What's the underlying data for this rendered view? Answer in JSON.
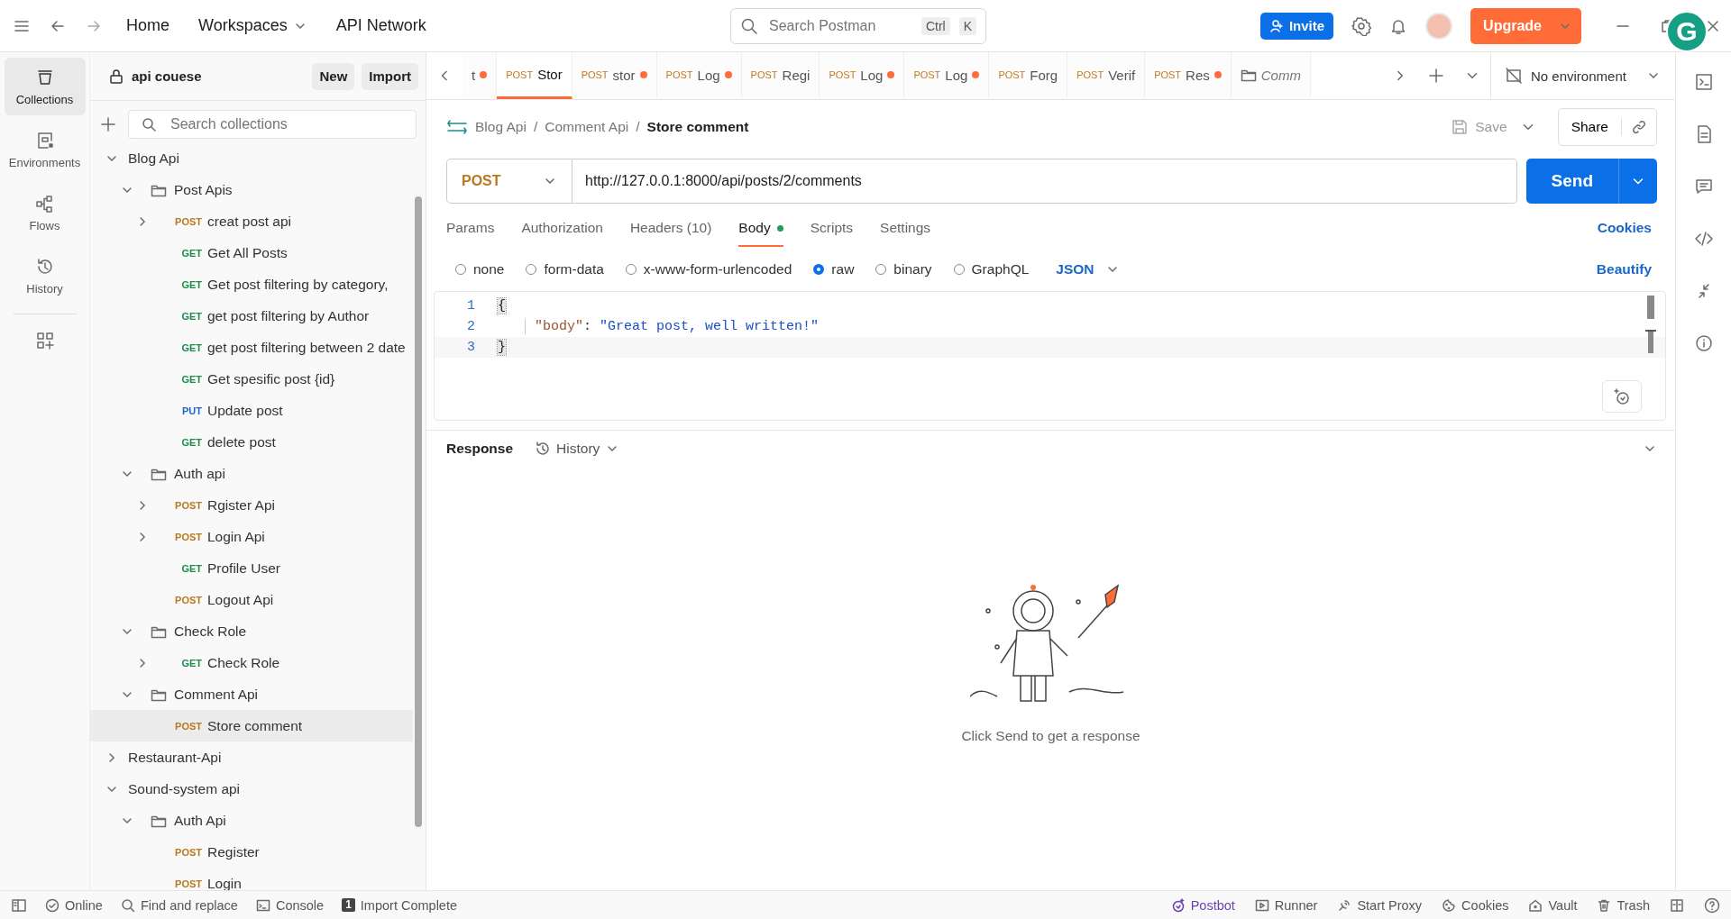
{
  "topbar": {
    "nav": [
      {
        "label": "Home",
        "dropdown": false
      },
      {
        "label": "Workspaces",
        "dropdown": true
      },
      {
        "label": "API Network",
        "dropdown": false
      }
    ],
    "search": {
      "placeholder": "Search Postman",
      "shortcut": [
        "Ctrl",
        "K"
      ]
    },
    "invite": "Invite",
    "upgrade": "Upgrade",
    "grammarly": "G"
  },
  "rail": [
    {
      "label": "Collections",
      "selected": true
    },
    {
      "label": "Environments",
      "selected": false
    },
    {
      "label": "Flows",
      "selected": false
    },
    {
      "label": "History",
      "selected": false
    }
  ],
  "sidebar": {
    "workspace": "api couese",
    "buttons": [
      "New",
      "Import"
    ],
    "search": {
      "placeholder": "Search collections"
    },
    "tree": [
      {
        "kind": "collection",
        "label": "Blog Api",
        "expanded": true,
        "selected": false,
        "children": [
          {
            "kind": "folder",
            "label": "Post Apis",
            "expanded": true,
            "selected": false,
            "children": [
              {
                "kind": "request",
                "method": "POST",
                "color": "#b7791f",
                "label": "creat post api",
                "expanded": false,
                "selected": false
              },
              {
                "kind": "request",
                "method": "GET",
                "color": "#1f8a4c",
                "label": "Get All Posts",
                "selected": false
              },
              {
                "kind": "request",
                "method": "GET",
                "color": "#1f8a4c",
                "label": "Get post filtering by category,",
                "selected": false
              },
              {
                "kind": "request",
                "method": "GET",
                "color": "#1f8a4c",
                "label": "get post filtering by Author",
                "selected": false
              },
              {
                "kind": "request",
                "method": "GET",
                "color": "#1f8a4c",
                "label": "get post filtering between 2 date",
                "selected": false
              },
              {
                "kind": "request",
                "method": "GET",
                "color": "#1f8a4c",
                "label": "Get spesific post {id}",
                "selected": false
              },
              {
                "kind": "request",
                "method": "PUT",
                "color": "#1b66c9",
                "label": "Update post",
                "selected": false
              },
              {
                "kind": "request",
                "method": "GET",
                "color": "#1f8a4c",
                "label": "delete post",
                "selected": false
              }
            ]
          },
          {
            "kind": "folder",
            "label": "Auth api",
            "expanded": true,
            "selected": false,
            "children": [
              {
                "kind": "request",
                "method": "POST",
                "color": "#b7791f",
                "label": "Rgister Api",
                "expanded": false,
                "selected": false
              },
              {
                "kind": "request",
                "method": "POST",
                "color": "#b7791f",
                "label": "Login Api",
                "expanded": false,
                "selected": false
              },
              {
                "kind": "request",
                "method": "GET",
                "color": "#1f8a4c",
                "label": "Profile User",
                "selected": false
              },
              {
                "kind": "request",
                "method": "POST",
                "color": "#b7791f",
                "label": "Logout Api",
                "selected": false
              }
            ]
          },
          {
            "kind": "folder",
            "label": "Check Role",
            "expanded": true,
            "selected": false,
            "children": [
              {
                "kind": "request",
                "method": "GET",
                "color": "#1f8a4c",
                "label": "Check Role",
                "expanded": false,
                "selected": false
              }
            ]
          },
          {
            "kind": "folder",
            "label": "Comment Api",
            "expanded": true,
            "selected": false,
            "children": [
              {
                "kind": "request",
                "method": "POST",
                "color": "#b7791f",
                "label": "Store comment",
                "selected": true
              }
            ]
          }
        ]
      },
      {
        "kind": "collection",
        "label": "Restaurant-Api",
        "expanded": false,
        "selected": false
      },
      {
        "kind": "collection",
        "label": "Sound-system api",
        "expanded": true,
        "selected": false,
        "children": [
          {
            "kind": "folder",
            "label": "Auth Api",
            "expanded": true,
            "selected": false,
            "children": [
              {
                "kind": "request",
                "method": "POST",
                "color": "#b7791f",
                "label": "Register",
                "selected": false
              },
              {
                "kind": "request",
                "method": "POST",
                "color": "#b7791f",
                "label": "Login",
                "selected": false
              }
            ]
          }
        ]
      }
    ]
  },
  "tabs": [
    {
      "kind": "request",
      "label": "t",
      "unsaved": true,
      "selected": false
    },
    {
      "kind": "request",
      "method": "POST",
      "label": "Stor",
      "unsaved": false,
      "selected": true
    },
    {
      "kind": "request",
      "method": "POST",
      "label": "stor",
      "unsaved": true,
      "selected": false
    },
    {
      "kind": "request",
      "method": "POST",
      "label": "Log",
      "unsaved": true,
      "selected": false
    },
    {
      "kind": "request",
      "method": "POST",
      "label": "Regi",
      "unsaved": false,
      "selected": false
    },
    {
      "kind": "request",
      "method": "POST",
      "label": "Log",
      "unsaved": true,
      "selected": false
    },
    {
      "kind": "request",
      "method": "POST",
      "label": "Log",
      "unsaved": true,
      "selected": false
    },
    {
      "kind": "request",
      "method": "POST",
      "label": "Forg",
      "unsaved": false,
      "selected": false
    },
    {
      "kind": "request",
      "method": "POST",
      "label": "Verif",
      "unsaved": false,
      "selected": false
    },
    {
      "kind": "request",
      "method": "POST",
      "label": "Res",
      "unsaved": true,
      "selected": false
    },
    {
      "kind": "folder",
      "label": "Comm",
      "unsaved": false,
      "selected": false
    }
  ],
  "environment": "No environment",
  "request": {
    "breadcrumb": [
      {
        "label": "Blog Api",
        "separator": "/"
      },
      {
        "label": "Comment Api",
        "separator": "/"
      },
      {
        "label": "Store comment"
      }
    ],
    "save": {
      "label": "Save",
      "disabled": true
    },
    "share": "Share",
    "method": "POST",
    "url": "http://127.0.0.1:8000/api/posts/2/comments",
    "send": "Send",
    "tabs": [
      {
        "label": "Params",
        "selected": false,
        "indicator": false
      },
      {
        "label": "Authorization",
        "selected": false,
        "indicator": false
      },
      {
        "label": "Headers (10)",
        "selected": false,
        "indicator": false
      },
      {
        "label": "Body",
        "selected": true,
        "indicator": true
      },
      {
        "label": "Scripts",
        "selected": false,
        "indicator": false
      },
      {
        "label": "Settings",
        "selected": false,
        "indicator": false
      }
    ],
    "cookies": "Cookies",
    "body_types": [
      {
        "label": "none",
        "selected": false
      },
      {
        "label": "form-data",
        "selected": false
      },
      {
        "label": "x-www-form-urlencoded",
        "selected": false
      },
      {
        "label": "raw",
        "selected": true
      },
      {
        "label": "binary",
        "selected": false
      },
      {
        "label": "GraphQL",
        "selected": false
      }
    ],
    "format": "JSON",
    "beautify": "Beautify",
    "code": [
      {
        "number": "1",
        "tokens": [
          {
            "kind": "brace",
            "text": "{"
          }
        ]
      },
      {
        "number": "2",
        "tokens": [
          {
            "kind": "key",
            "text": "\"body\""
          },
          {
            "kind": "punct",
            "text": ": "
          },
          {
            "kind": "string",
            "text": "\"Great post, well written!\""
          }
        ]
      },
      {
        "number": "3",
        "tokens": [
          {
            "kind": "brace",
            "text": "}"
          }
        ]
      }
    ]
  },
  "response": {
    "title": "Response",
    "history": "History",
    "empty_text": "Click Send to get a response"
  },
  "status_bar": {
    "left": [
      {
        "label": "Online"
      },
      {
        "label": "Find and replace"
      },
      {
        "label": "Console"
      },
      {
        "label": "Import Complete",
        "badge": "1"
      }
    ],
    "right": [
      {
        "label": "Postbot"
      },
      {
        "label": "Runner"
      },
      {
        "label": "Start Proxy"
      },
      {
        "label": "Cookies"
      },
      {
        "label": "Vault"
      },
      {
        "label": "Trash"
      }
    ]
  }
}
